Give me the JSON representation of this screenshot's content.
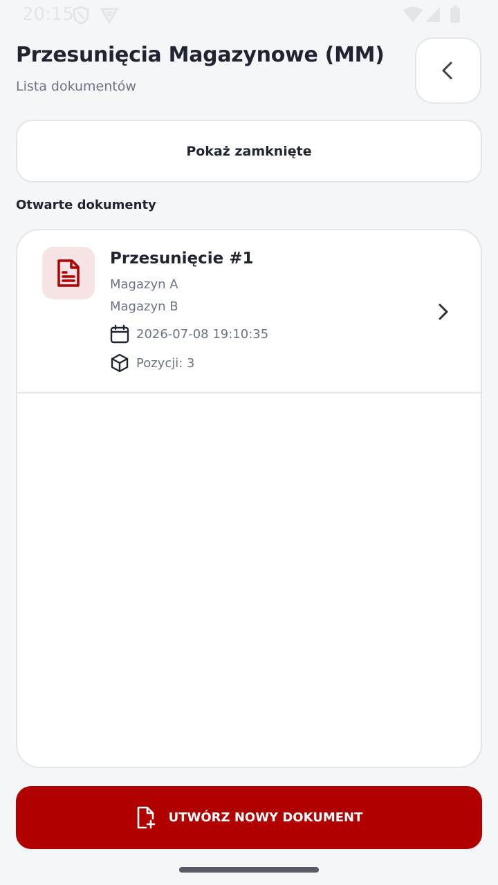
{
  "status_bar": {
    "time": "20:15",
    "icons": [
      "shield-icon",
      "vpn-icon",
      "wifi-icon",
      "signal-icon",
      "battery-icon"
    ]
  },
  "header": {
    "title": "Przesunięcia Magazynowe (MM)",
    "subtitle": "Lista dokumentów",
    "back_icon": "chevron-left-icon"
  },
  "filter": {
    "show_closed_label": "Pokaż zamknięte"
  },
  "section": {
    "open_documents_label": "Otwarte dokumenty"
  },
  "documents": [
    {
      "title": "Przesunięcie #1",
      "from_warehouse": "Magazyn A",
      "to_warehouse": "Magazyn B",
      "date": "2026-07-08 19:10:35",
      "positions": "Pozycji: 3",
      "icon": "document-icon"
    }
  ],
  "actions": {
    "create_label": "UTWÓRZ NOWY DOKUMENT",
    "create_icon": "file-plus-icon"
  },
  "colors": {
    "accent": "#b00000",
    "accent_soft": "#f6e4e4",
    "background": "#f5f6f8",
    "text": "#1f2430",
    "muted": "#6b7486"
  }
}
